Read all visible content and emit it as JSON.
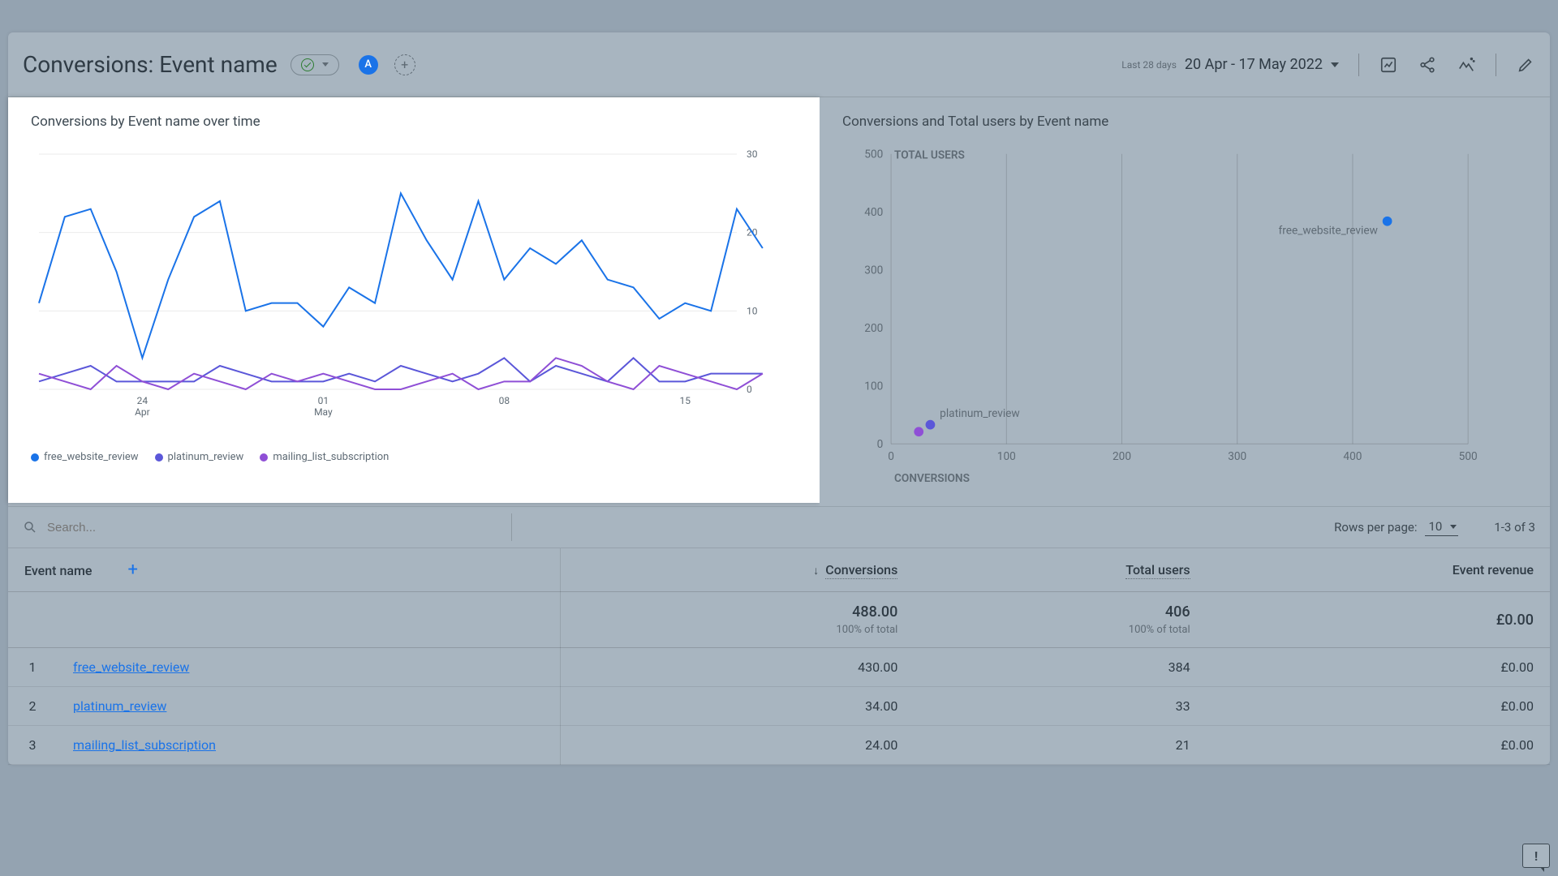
{
  "header": {
    "title": "Conversions: Event name",
    "badge": "A",
    "date_label": "Last 28 days",
    "date_value": "20 Apr - 17 May 2022"
  },
  "chart_data": [
    {
      "type": "line",
      "title": "Conversions by Event name over time",
      "x_label_rows": [
        "24",
        "Apr",
        "01",
        "May",
        "08",
        "15"
      ],
      "ylim": [
        0,
        30
      ],
      "yticks": [
        0,
        10,
        20,
        30
      ],
      "x": [
        "Apr 20",
        "Apr 21",
        "Apr 22",
        "Apr 23",
        "Apr 24",
        "Apr 25",
        "Apr 26",
        "Apr 27",
        "Apr 28",
        "Apr 29",
        "Apr 30",
        "May 01",
        "May 02",
        "May 03",
        "May 04",
        "May 05",
        "May 06",
        "May 07",
        "May 08",
        "May 09",
        "May 10",
        "May 11",
        "May 12",
        "May 13",
        "May 14",
        "May 15",
        "May 16",
        "May 17"
      ],
      "series": [
        {
          "name": "free_website_review",
          "color": "#1a73e8",
          "values": [
            11,
            22,
            23,
            15,
            4,
            14,
            22,
            24,
            10,
            11,
            11,
            8,
            13,
            11,
            25,
            19,
            14,
            24,
            14,
            18,
            16,
            19,
            14,
            13,
            9,
            11,
            10,
            23,
            18
          ]
        },
        {
          "name": "platinum_review",
          "color": "#5b57d9",
          "values": [
            1,
            2,
            3,
            1,
            1,
            1,
            1,
            3,
            2,
            1,
            1,
            1,
            2,
            1,
            3,
            2,
            1,
            2,
            4,
            1,
            3,
            2,
            1,
            4,
            1,
            1,
            2,
            2,
            2
          ]
        },
        {
          "name": "mailing_list_subscription",
          "color": "#8f4fd6",
          "values": [
            2,
            1,
            0,
            3,
            1,
            0,
            2,
            1,
            0,
            2,
            1,
            2,
            1,
            0,
            0,
            1,
            2,
            0,
            1,
            1,
            4,
            3,
            1,
            0,
            3,
            2,
            1,
            0,
            2
          ]
        }
      ],
      "legend": [
        "free_website_review",
        "platinum_review",
        "mailing_list_subscription"
      ]
    },
    {
      "type": "scatter",
      "title": "Conversions and Total users by Event name",
      "xlabel": "CONVERSIONS",
      "ylabel": "TOTAL USERS",
      "xlim": [
        0,
        500
      ],
      "ylim": [
        0,
        500
      ],
      "xticks": [
        0,
        100,
        200,
        300,
        400,
        500
      ],
      "yticks": [
        0,
        100,
        200,
        300,
        400,
        500
      ],
      "points": [
        {
          "name": "free_website_review",
          "x": 430,
          "y": 384,
          "color": "#1a73e8"
        },
        {
          "name": "platinum_review",
          "x": 34,
          "y": 33,
          "color": "#5b57d9"
        },
        {
          "name": "mailing_list_subscription",
          "x": 24,
          "y": 21,
          "color": "#8f4fd6"
        }
      ],
      "visible_labels": [
        "free_website_review",
        "platinum_review"
      ]
    }
  ],
  "table": {
    "search_placeholder": "Search...",
    "rows_per_page_label": "Rows per page:",
    "rows_per_page_value": "10",
    "range_label": "1-3 of 3",
    "columns": [
      "Event name",
      "Conversions",
      "Total users",
      "Event revenue"
    ],
    "sort_column": "Conversions",
    "totals": {
      "conversions": "488.00",
      "conversions_sub": "100% of total",
      "total_users": "406",
      "total_users_sub": "100% of total",
      "revenue": "£0.00"
    },
    "rows": [
      {
        "idx": "1",
        "name": "free_website_review",
        "conversions": "430.00",
        "total_users": "384",
        "revenue": "£0.00"
      },
      {
        "idx": "2",
        "name": "platinum_review",
        "conversions": "34.00",
        "total_users": "33",
        "revenue": "£0.00"
      },
      {
        "idx": "3",
        "name": "mailing_list_subscription",
        "conversions": "24.00",
        "total_users": "21",
        "revenue": "£0.00"
      }
    ]
  },
  "feedback": "!"
}
